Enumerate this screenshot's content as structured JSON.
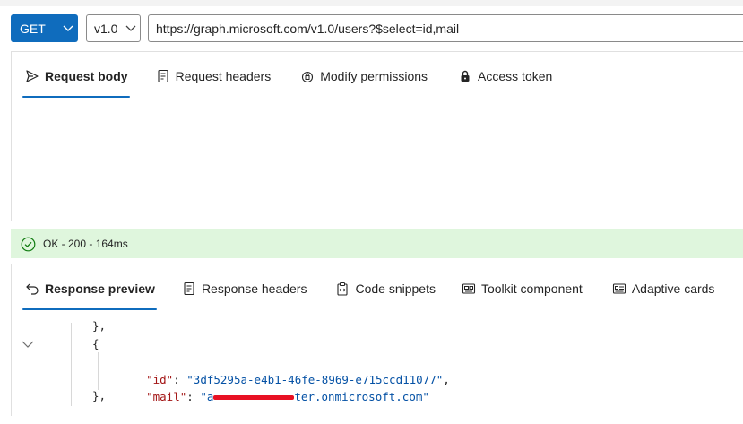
{
  "toolbar": {
    "method": "GET",
    "version": "v1.0",
    "url": "https://graph.microsoft.com/v1.0/users?$select=id,mail"
  },
  "request_tabs": [
    {
      "label": "Request body",
      "icon": "send-icon"
    },
    {
      "label": "Request headers",
      "icon": "document-icon"
    },
    {
      "label": "Modify permissions",
      "icon": "shield-lock-icon"
    },
    {
      "label": "Access token",
      "icon": "lock-icon"
    }
  ],
  "status": {
    "text": "OK - 200 - 164ms",
    "color": "#dff6dd",
    "icon": "check-circle-icon"
  },
  "response_tabs": [
    {
      "label": "Response preview",
      "icon": "undo-arrow-icon"
    },
    {
      "label": "Response headers",
      "icon": "document-icon"
    },
    {
      "label": "Code snippets",
      "icon": "clipboard-icon"
    },
    {
      "label": "Toolkit component",
      "icon": "component-icon"
    },
    {
      "label": "Adaptive cards",
      "icon": "card-icon"
    }
  ],
  "code": {
    "close_obj": "},",
    "open_obj": "{",
    "id_key": "\"id\"",
    "id_value": "\"3df5295a-e4b1-46fe-8969-e715ccd11077\"",
    "mail_key": "\"mail\"",
    "mail_prefix": "\"a",
    "mail_suffix": "ter.onmicrosoft.com\"",
    "close_obj2": "},"
  },
  "colors": {
    "accent": "#0f6cbd",
    "json_key": "#a31515",
    "json_string": "#0451a5",
    "redaction": "#e81123"
  }
}
